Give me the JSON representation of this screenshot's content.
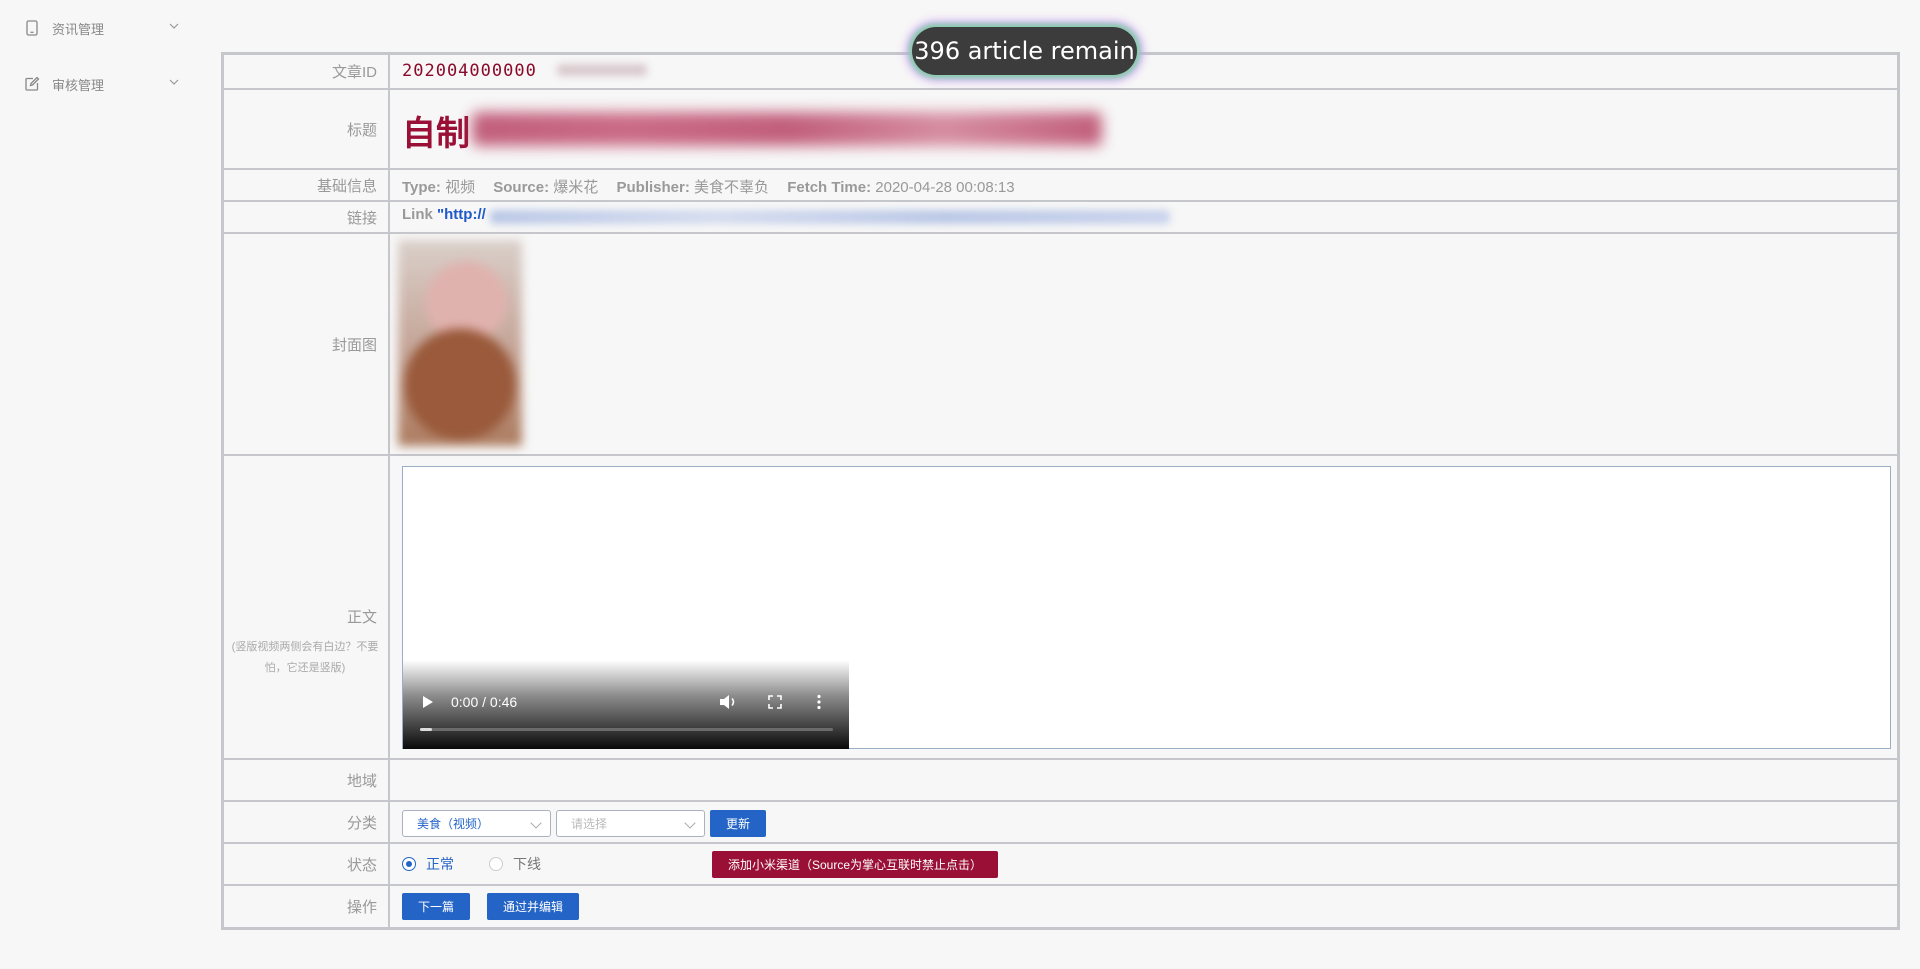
{
  "sidebar": {
    "items": [
      {
        "label": "资讯管理",
        "icon": "tablet-icon"
      },
      {
        "label": "审核管理",
        "icon": "edit-icon"
      }
    ]
  },
  "badge": {
    "text": "396 article remain"
  },
  "rows": {
    "article_id": {
      "label": "文章ID",
      "value": "202004000000"
    },
    "title": {
      "label": "标题",
      "value": "自制"
    },
    "basic_info": {
      "label": "基础信息",
      "type_key": "Type:",
      "type_val": "视频",
      "source_key": "Source:",
      "source_val": "爆米花",
      "publisher_key": "Publisher:",
      "publisher_val": "美食不辜负",
      "fetch_key": "Fetch Time:",
      "fetch_val": "2020-04-28 00:08:13"
    },
    "link": {
      "label": "链接",
      "prefix": "Link ",
      "url": "\"http://"
    },
    "cover": {
      "label": "封面图"
    },
    "body": {
      "label": "正文",
      "note": "(竖版视频两侧会有白边？不要怕，它还是竖版)",
      "player_time": "0:00 / 0:46",
      "progress": 0.03
    },
    "region": {
      "label": "地域"
    },
    "category": {
      "label": "分类",
      "select1": "美食（视频）",
      "select2_placeholder": "请选择",
      "update_btn": "更新"
    },
    "status": {
      "label": "状态",
      "option_normal": "正常",
      "option_offline": "下线",
      "selected": "正常",
      "xiaomi_btn": "添加小米渠道（Source为掌心互联时禁止点击）"
    },
    "actions": {
      "label": "操作",
      "next_btn": "下一篇",
      "approve_btn": "通过并编辑"
    }
  },
  "colors": {
    "accent_blue": "#2464c6",
    "accent_red": "#9a0f36",
    "border": "#c5c7cc"
  }
}
